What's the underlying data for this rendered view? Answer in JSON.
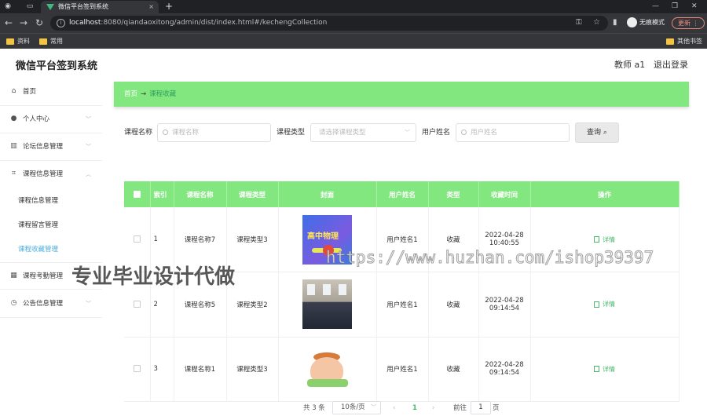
{
  "browser": {
    "tab_title": "微信平台签到系统",
    "new_tab": "+",
    "url_host": "localhost",
    "url_rest": ":8080/qiandaoxitong/admin/dist/index.html#/kechengCollection",
    "incognito_label": "无痕模式",
    "update_label": "更新",
    "bookmarks": [
      "资料",
      "常用"
    ],
    "other_bookmarks": "其他书签"
  },
  "header": {
    "title": "微信平台签到系统",
    "user": "教师 a1",
    "logout": "退出登录"
  },
  "sidebar": {
    "home": "首页",
    "items": [
      {
        "label": "个人中心",
        "icon": "user-icon"
      },
      {
        "label": "论坛信息管理",
        "icon": "chart-icon"
      },
      {
        "label": "课程信息管理",
        "icon": "crop-icon"
      }
    ],
    "sub_items": [
      "课程信息管理",
      "课程留言管理",
      "课程收藏管理"
    ],
    "items_after": [
      {
        "label": "课程考勤管理",
        "icon": "grid-icon"
      },
      {
        "label": "公告信息管理",
        "icon": "clock-icon"
      }
    ]
  },
  "breadcrumb": {
    "home": "首页",
    "arrow": "→",
    "current": "课程收藏"
  },
  "filters": {
    "course_name_label": "课程名称",
    "course_name_placeholder": "课程名称",
    "course_type_label": "课程类型",
    "course_type_placeholder": "请选择课程类型",
    "user_name_label": "用户姓名",
    "user_name_placeholder": "用户姓名",
    "query_button": "查询"
  },
  "table": {
    "headers": [
      "索引",
      "课程名称",
      "课程类型",
      "封面",
      "用户姓名",
      "类型",
      "收藏时间",
      "操作"
    ],
    "rows": [
      {
        "index": "1",
        "name": "课程名称7",
        "type": "课程类型3",
        "cover_text": "高中物理",
        "user": "用户姓名1",
        "kind": "收藏",
        "date": "2022-04-28",
        "time": "10:40:55",
        "action": "详情"
      },
      {
        "index": "2",
        "name": "课程名称5",
        "type": "课程类型2",
        "cover_text": "",
        "user": "用户姓名1",
        "kind": "收藏",
        "date": "2022-04-28",
        "time": "09:14:54",
        "action": "详情"
      },
      {
        "index": "3",
        "name": "课程名称1",
        "type": "课程类型3",
        "cover_text": "",
        "user": "用户姓名1",
        "kind": "收藏",
        "date": "2022-04-28",
        "time": "09:14:54",
        "action": "详情"
      }
    ]
  },
  "pagination": {
    "total": "共 3 条",
    "page_size": "10条/页",
    "prev": "‹",
    "current_page": "1",
    "next": "›",
    "goto_label": "前往",
    "goto_value": "1",
    "page_unit": "页"
  },
  "watermark": {
    "text": "专业毕业设计代做",
    "url": "https://www.huzhan.com/ishop39397"
  },
  "colors": {
    "accent_green": "#83e780",
    "active_link": "#49b0de",
    "detail_green": "#49b86a"
  }
}
